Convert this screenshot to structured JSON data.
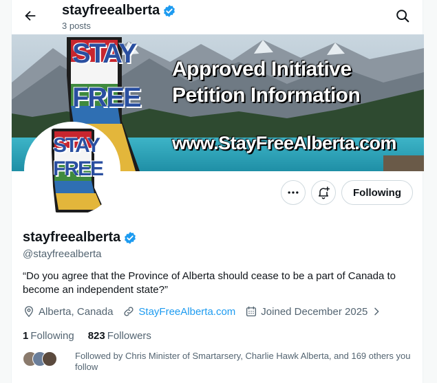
{
  "header": {
    "title": "stayfreealberta",
    "posts": "3 posts",
    "back_icon": "arrow-left-icon",
    "search_icon": "search-icon"
  },
  "banner": {
    "logo_text_top": "STAY",
    "logo_text_bottom": "FREE",
    "line1": "Approved Initiative",
    "line2": "Petition Information",
    "url": "www.StayFreeAlberta.com"
  },
  "avatar": {
    "text_top": "STAY",
    "text_bottom": "FREE"
  },
  "actions": {
    "more_icon": "more-horizontal-icon",
    "notify_icon": "bell-plus-icon",
    "following_label": "Following"
  },
  "profile": {
    "name": "stayfreealberta",
    "handle": "@stayfreealberta",
    "bio": "“Do you agree that the Province of Alberta should cease to be a part of Canada to become an independent state?”",
    "location": "Alberta, Canada",
    "website": "StayFreeAlberta.com",
    "joined": "Joined December 2025",
    "following_count": "1",
    "following_label": "Following",
    "followers_count": "823",
    "followers_label": "Followers",
    "followed_by": "Followed by Chris Minister of Smartarsery, Charlie Hawk Alberta, and 169 others you follow"
  },
  "colors": {
    "verified": "#1d9bf0",
    "link": "#1d9bf0",
    "secondary_text": "#536471",
    "border": "#cfd9de"
  }
}
